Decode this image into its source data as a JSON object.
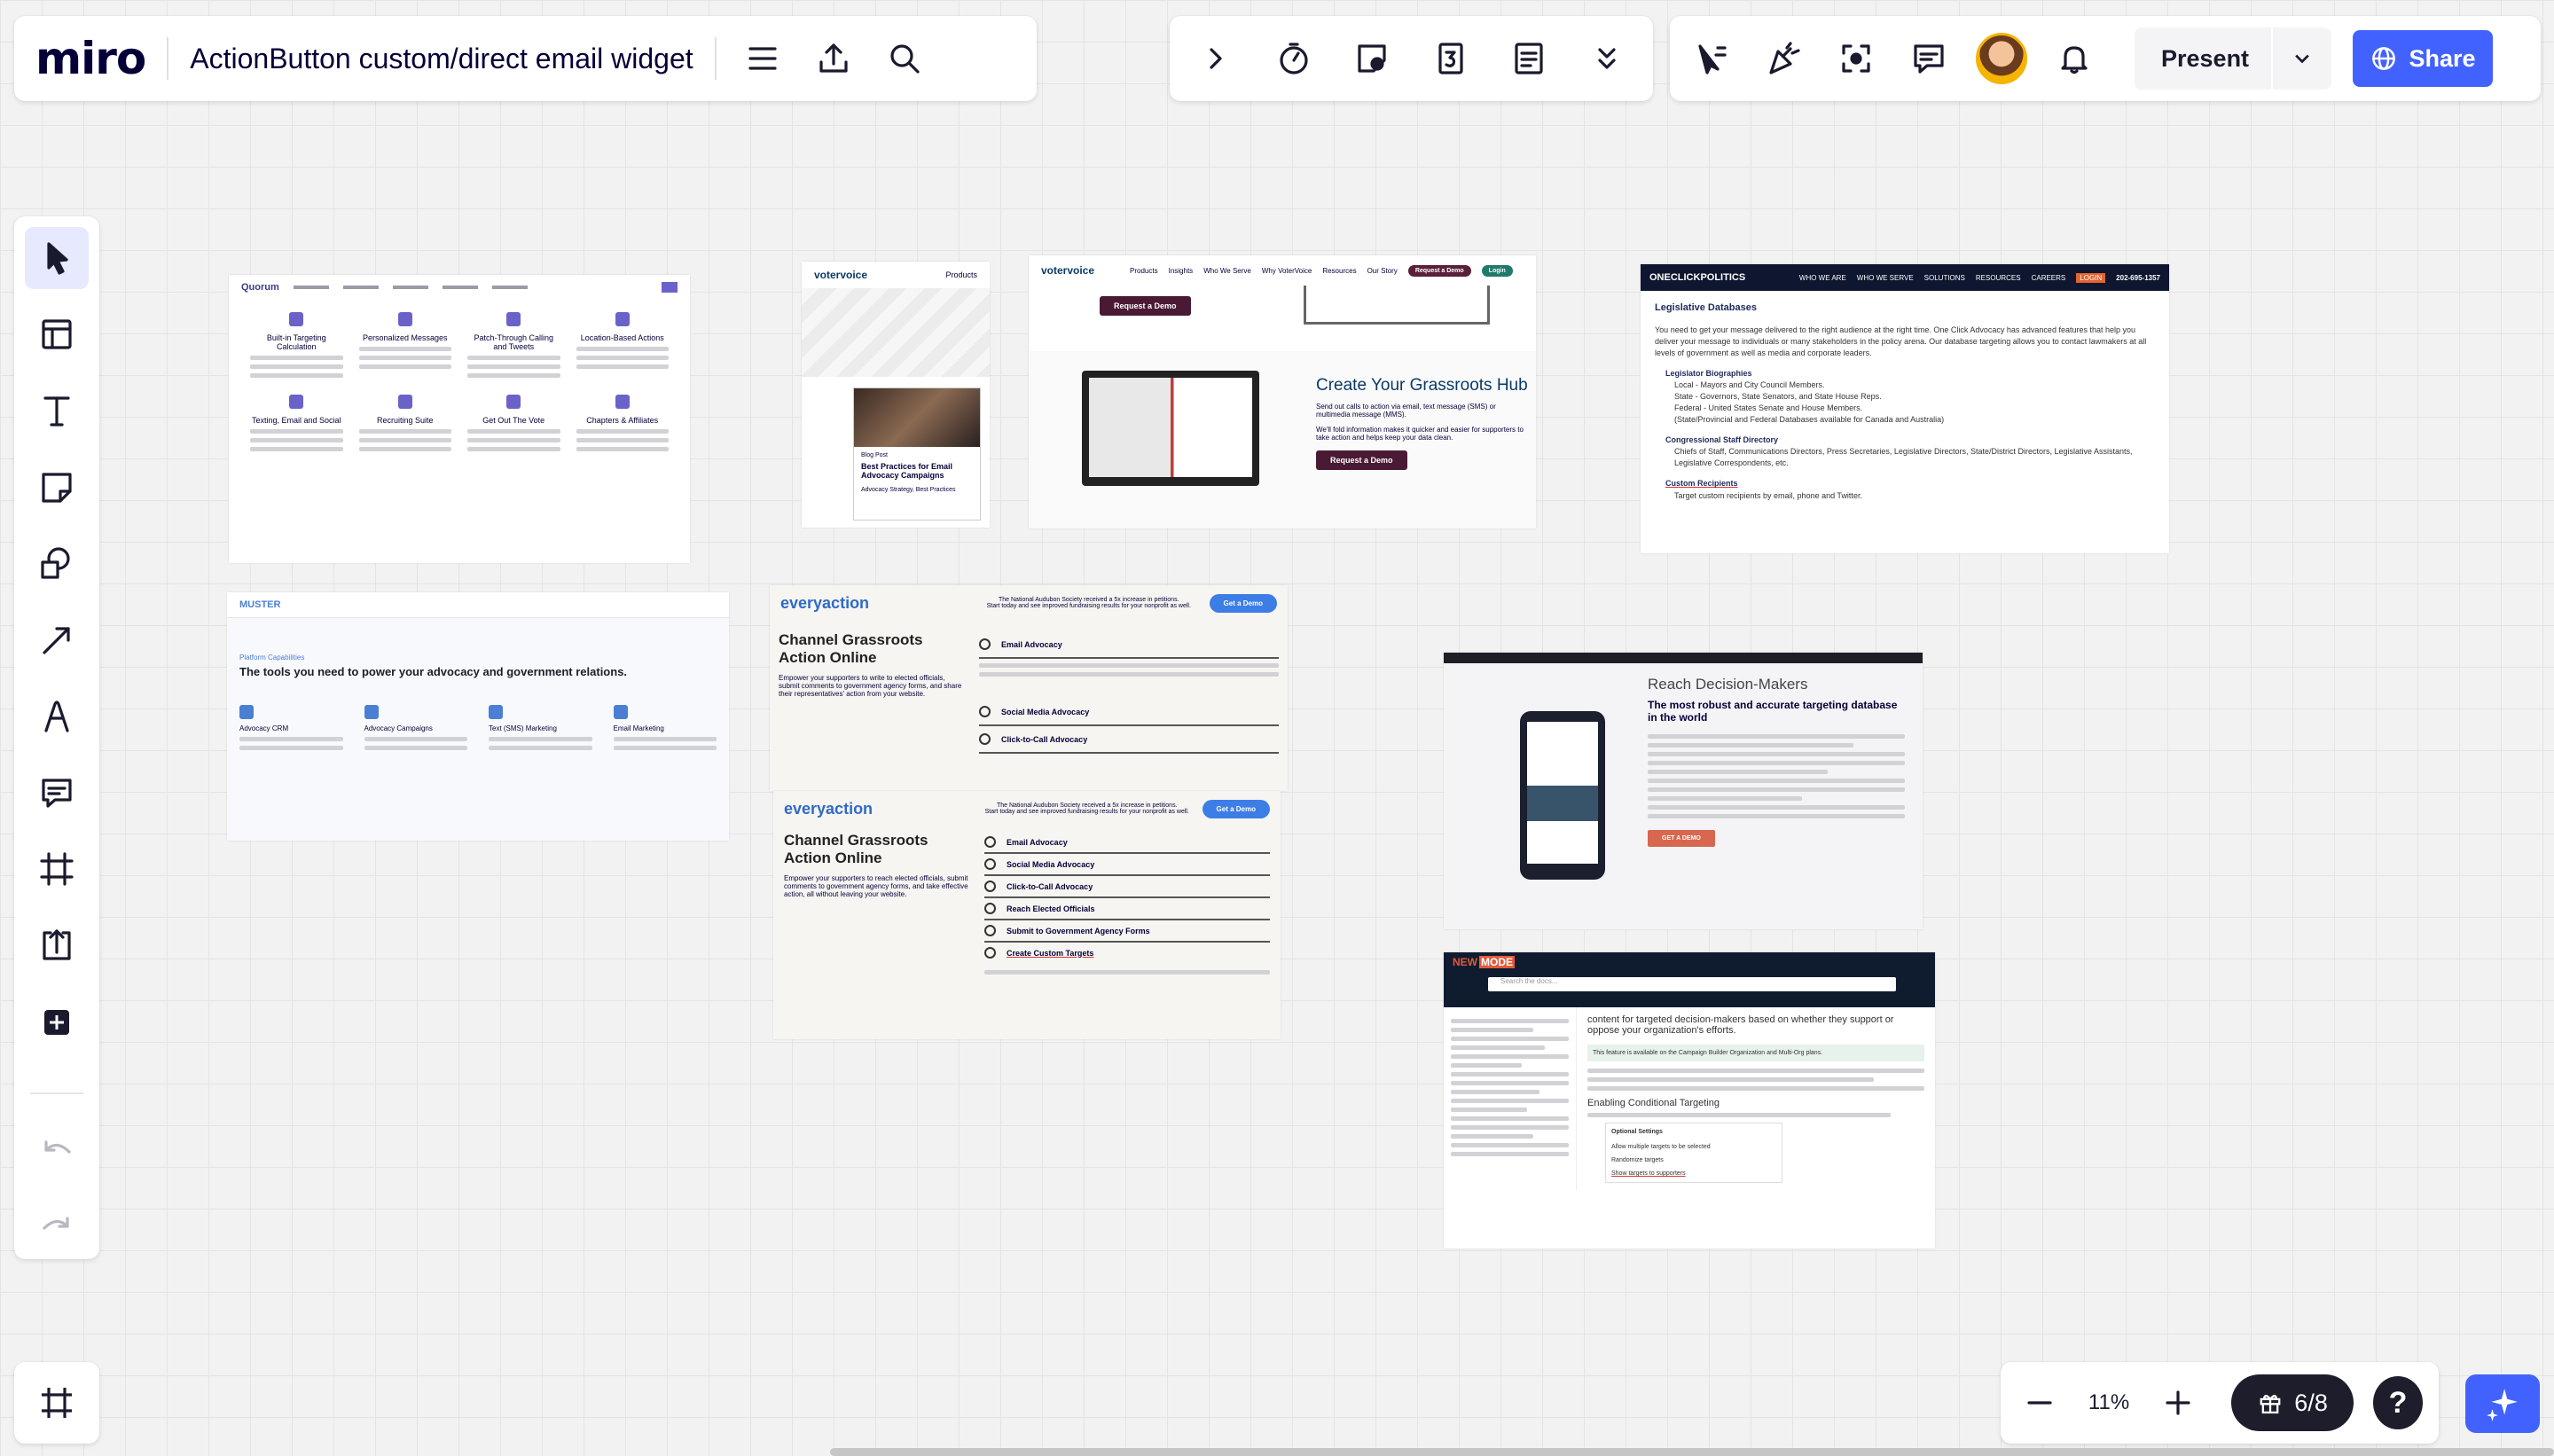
{
  "app": {
    "logo": "miro",
    "board_title": "ActionButton custom/direct email widget"
  },
  "toolbar_top_right": {
    "present_label": "Present",
    "share_label": "Share"
  },
  "bottom_bar": {
    "zoom_level": "11%",
    "gift_count": "6/8",
    "help_label": "?"
  },
  "colors": {
    "accent": "#4262ff",
    "dark": "#1d1d2b",
    "canvas": "#f2f2f2"
  },
  "canvas_cards": {
    "quorum": {
      "brand": "Quorum",
      "features": [
        "Built-in Targeting Calculation",
        "Personalized Messages",
        "Patch-Through Calling and Tweets",
        "Location-Based Actions",
        "Texting, Email and Social",
        "Recruiting Suite",
        "Get Out The Vote",
        "Chapters & Affiliates"
      ]
    },
    "votervoice_blog": {
      "brand": "votervoice",
      "menu": "Products",
      "tag": "Blog Post",
      "title": "Best Practices for Email Advocacy Campaigns",
      "tags": "Advocacy Strategy, Best Practices"
    },
    "votervoice_hub": {
      "brand": "votervoice",
      "nav": [
        "Products",
        "Insights",
        "Who We Serve",
        "Why VoterVoice",
        "Resources",
        "Our Story"
      ],
      "nav_button": "Request a Demo",
      "login": "Login",
      "top_button": "Request a Demo",
      "hub_title": "Create Your Grassroots Hub",
      "hub_text": "Send out calls to action via email, text message (SMS) or multimedia message (MMS).",
      "hub_text2": "We'll fold information makes it quicker and easier for supporters to take action and helps keep your data clean.",
      "hub_button": "Request a Demo"
    },
    "oneclick": {
      "brand": "ONECLICKPOLITICS",
      "nav": [
        "WHO WE ARE",
        "WHO WE SERVE",
        "SOLUTIONS",
        "RESOURCES",
        "CAREERS"
      ],
      "login": "LOGIN",
      "phone": "202-695-1357",
      "heading": "Legislative Databases",
      "intro": "You need to get your message delivered to the right audience at the right time. One Click Advocacy has advanced features that help you deliver your message to individuals or many stakeholders in the policy arena. Our database targeting allows you to contact lawmakers at all levels of government as well as media and corporate leaders.",
      "s1_title": "Legislator Biographies",
      "s1_lines": [
        "Local - Mayors and City Council Members.",
        "State - Governors, State Senators, and State House Reps.",
        "Federal - United States Senate and House Members.",
        "(State/Provincial and Federal Databases available for Canada and Australia)"
      ],
      "s2_title": "Congressional Staff Directory",
      "s2_text": "Chiefs of Staff, Communications Directors, Press Secretaries, Legislative Directors, State/District Directors, Legislative Assistants, Legislative Correspondents, etc.",
      "s3_title": "Custom Recipients",
      "s3_text": "Target custom recipients by email, phone and Twitter."
    },
    "muster": {
      "brand": "MUSTER",
      "kicker": "Platform Capabilities",
      "heading": "The tools you need to power your advocacy and government relations.",
      "items": [
        "Advocacy CRM",
        "Advocacy Campaigns",
        "Text (SMS) Marketing",
        "Email Marketing"
      ]
    },
    "everyaction1": {
      "brand": "everyaction",
      "banner": "The National Audubon Society received a 5x increase in petitions.",
      "banner2": "Start today and see improved fundraising results for your nonprofit as well.",
      "button": "Get a Demo",
      "heading": "Channel Grassroots Action Online",
      "text": "Empower your supporters to write to elected officials, submit comments to government agency forms, and share their representatives' action from your website.",
      "items": [
        "Email Advocacy",
        "Social Media Advocacy",
        "Click-to-Call Advocacy"
      ]
    },
    "everyaction2": {
      "brand": "everyaction",
      "banner": "The National Audubon Society received a 5x increase in petitions.",
      "banner2": "Start today and see improved fundraising results for your nonprofit as well.",
      "button": "Get a Demo",
      "heading": "Channel Grassroots Action Online",
      "text": "Empower your supporters to reach elected officials, submit comments to government agency forms, and take effective action, all without leaving your website.",
      "items": [
        "Email Advocacy",
        "Social Media Advocacy",
        "Click-to-Call Advocacy",
        "Reach Elected Officials",
        "Submit to Government Agency Forms",
        "Create Custom Targets"
      ]
    },
    "reach": {
      "title": "Reach Decision-Makers",
      "heading": "The most robust and accurate targeting database in the world",
      "button": "GET A DEMO"
    },
    "newmode": {
      "brand_a": "NEW",
      "brand_b": "MODE",
      "search_placeholder": "Search the docs...",
      "text": "content for targeted decision-makers based on whether they support or oppose your organization's efforts.",
      "note": "This feature is available on the Campaign Builder Organization and Multi-Org plans.",
      "section": "Enabling Conditional Targeting",
      "options_title": "Optional Settings",
      "options": [
        "Allow multiple targets to be selected",
        "Randomize targets",
        "Show targets to supporters"
      ]
    }
  }
}
